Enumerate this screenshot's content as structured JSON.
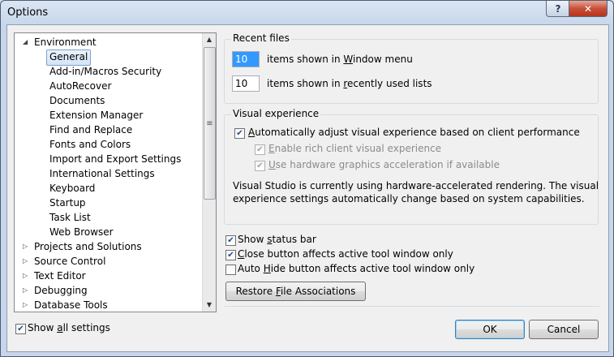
{
  "window": {
    "title": "Options",
    "help_label": "?",
    "close_label": "✕"
  },
  "tree": {
    "items": [
      {
        "label": "Environment",
        "expanded": true,
        "level": 0
      },
      {
        "label": "General",
        "selected": true,
        "level": 1
      },
      {
        "label": "Add-in/Macros Security",
        "level": 1
      },
      {
        "label": "AutoRecover",
        "level": 1
      },
      {
        "label": "Documents",
        "level": 1
      },
      {
        "label": "Extension Manager",
        "level": 1
      },
      {
        "label": "Find and Replace",
        "level": 1
      },
      {
        "label": "Fonts and Colors",
        "level": 1
      },
      {
        "label": "Import and Export Settings",
        "level": 1
      },
      {
        "label": "International Settings",
        "level": 1
      },
      {
        "label": "Keyboard",
        "level": 1
      },
      {
        "label": "Startup",
        "level": 1
      },
      {
        "label": "Task List",
        "level": 1
      },
      {
        "label": "Web Browser",
        "level": 1
      },
      {
        "label": "Projects and Solutions",
        "level": 0
      },
      {
        "label": "Source Control",
        "level": 0
      },
      {
        "label": "Text Editor",
        "level": 0
      },
      {
        "label": "Debugging",
        "level": 0
      },
      {
        "label": "Database Tools",
        "level": 0
      }
    ]
  },
  "recent_files": {
    "title": "Recent files",
    "window_menu_count": "10",
    "window_menu_label_pre": "items shown in ",
    "window_menu_label_accel": "W",
    "window_menu_label_post": "indow menu",
    "recent_count": "10",
    "recent_label_pre": "items shown in ",
    "recent_label_accel": "r",
    "recent_label_post": "ecently used lists"
  },
  "visual_experience": {
    "title": "Visual experience",
    "auto_adjust": {
      "accel": "A",
      "rest": "utomatically adjust visual experience based on client performance",
      "checked": true
    },
    "rich_client": {
      "accel": "E",
      "rest": "nable rich client visual experience",
      "checked": true,
      "enabled": false
    },
    "hardware_accel": {
      "accel": "U",
      "rest": "se hardware graphics acceleration if available",
      "checked": true,
      "enabled": false
    },
    "info_line1": "Visual Studio is currently using hardware-accelerated rendering. The visual",
    "info_line2": "experience settings automatically change based on system capabilities."
  },
  "options": {
    "status_bar": {
      "pre": "Show ",
      "accel": "s",
      "post": "tatus bar",
      "checked": true
    },
    "close_button": {
      "pre": "",
      "accel": "C",
      "post": "lose button affects active tool window only",
      "checked": true
    },
    "auto_hide": {
      "pre": "Auto ",
      "accel": "H",
      "post": "ide button affects active tool window only",
      "checked": false
    },
    "restore_button": {
      "pre": "Restore ",
      "accel": "F",
      "post": "ile Associations"
    }
  },
  "footer": {
    "show_all": {
      "pre": "Show ",
      "accel": "a",
      "post": "ll settings",
      "checked": true
    },
    "ok_label": "OK",
    "cancel_label": "Cancel"
  },
  "check_glyph": "✔",
  "colors": {
    "title_gradient_top": "#dbe6f3",
    "close_red": "#c8503a",
    "selection_blue": "#3399ff"
  }
}
